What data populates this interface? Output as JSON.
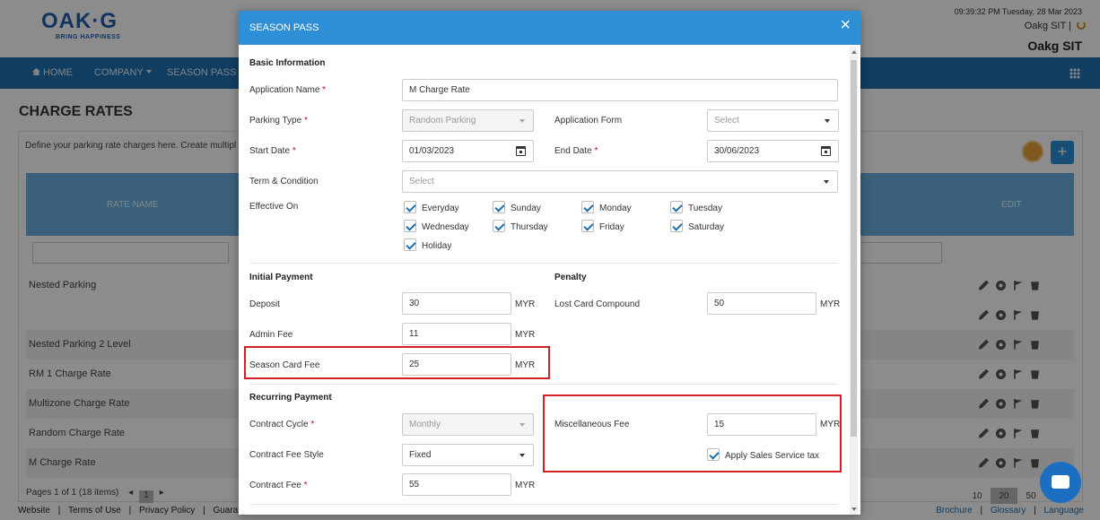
{
  "header": {
    "logo_text": "OAK·G",
    "logo_tagline": "BRING HAPPINESS",
    "datetime": "09:39:32 PM Tuesday, 28 Mar 2023",
    "user": "Oakg SIT |",
    "company": "Oakg SIT"
  },
  "nav": {
    "home": "HOME",
    "company": "COMPANY",
    "season_pass": "SEASON PASS"
  },
  "page": {
    "title": "CHARGE RATES",
    "description": "Define your parking rate charges here. Create multipl",
    "columns": {
      "rate_name": "RATE NAME",
      "edit": "EDIT"
    },
    "rows": [
      "Nested Parking",
      "",
      "Nested Parking 2 Level",
      "RM 1 Charge Rate",
      "Multizone Charge Rate",
      "Random Charge Rate",
      "M Charge Rate"
    ],
    "pager_text": "Pages 1 of 1 (18 items)",
    "pager_prev": "◂",
    "pager_page": "1",
    "pager_next": "▸",
    "page_sizes": [
      "10",
      "20",
      "50"
    ],
    "add_label": "+"
  },
  "footer": {
    "left": [
      "Website",
      "|",
      "Terms of Use",
      "|",
      "Privacy Policy",
      "|",
      "Guaran"
    ],
    "right": [
      "Brochure",
      "|",
      "Glossary",
      "|",
      "Language"
    ]
  },
  "modal": {
    "title": "SEASON PASS",
    "close": "×",
    "basic_info": "Basic Information",
    "application_name": {
      "label": "Application Name",
      "value": "M Charge Rate"
    },
    "parking_type": {
      "label": "Parking Type",
      "value": "Random Parking"
    },
    "application_form": {
      "label": "Application Form",
      "value": "Select"
    },
    "start_date": {
      "label": "Start Date",
      "value": "01/03/2023"
    },
    "end_date": {
      "label": "End Date",
      "value": "30/06/2023"
    },
    "term_condition": {
      "label": "Term & Condition",
      "value": "Select"
    },
    "effective_on": {
      "label": "Effective On",
      "days": [
        "Everyday",
        "Sunday",
        "Monday",
        "Tuesday",
        "Wednesday",
        "Thursday",
        "Friday",
        "Saturday",
        "Holiday"
      ]
    },
    "initial_payment": "Initial Payment",
    "penalty": "Penalty",
    "deposit": {
      "label": "Deposit",
      "value": "30",
      "unit": "MYR"
    },
    "lost_card": {
      "label": "Lost Card Compound",
      "value": "50",
      "unit": "MYR"
    },
    "admin_fee": {
      "label": "Admin Fee",
      "value": "11",
      "unit": "MYR"
    },
    "season_card_fee": {
      "label": "Season Card Fee",
      "value": "25",
      "unit": "MYR"
    },
    "recurring_payment": "Recurring Payment",
    "contract_cycle": {
      "label": "Contract Cycle",
      "value": "Monthly"
    },
    "misc_fee": {
      "label": "Miscellaneous Fee",
      "value": "15",
      "unit": "MYR"
    },
    "contract_fee_style": {
      "label": "Contract Fee Style",
      "value": "Fixed"
    },
    "apply_tax": "Apply Sales Service tax",
    "contract_fee": {
      "label": "Contract Fee",
      "value": "55",
      "unit": "MYR"
    },
    "required_mark": "*"
  }
}
